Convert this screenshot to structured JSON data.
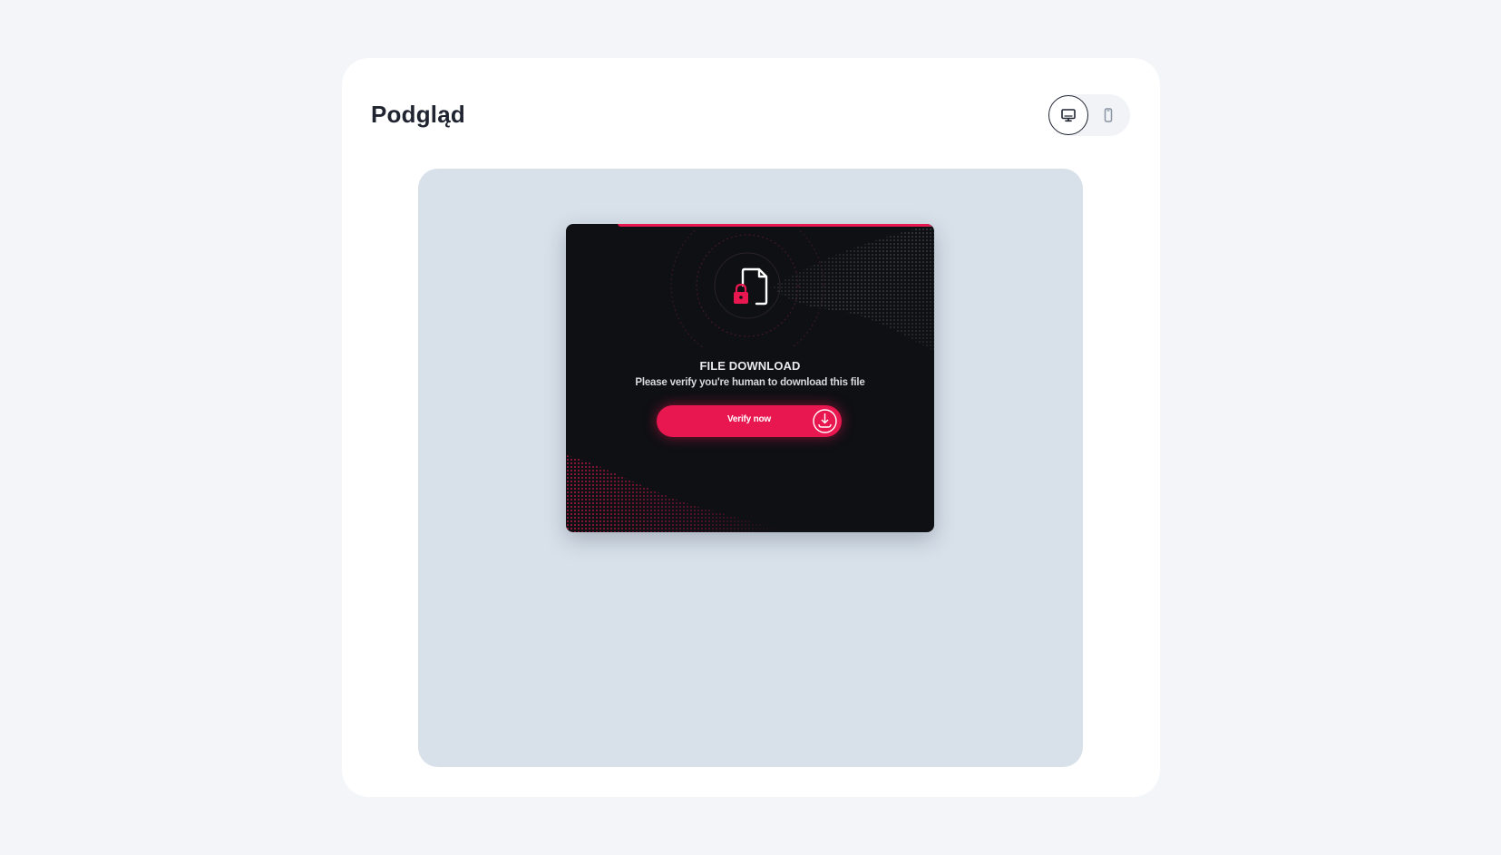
{
  "panel": {
    "title": "Podgląd"
  },
  "device_toggle": {
    "options": [
      {
        "icon": "desktop-icon",
        "active": true
      },
      {
        "icon": "mobile-icon",
        "active": false
      }
    ]
  },
  "popup": {
    "title": "FILE DOWNLOAD",
    "subtitle": "Please verify you're human to download this file",
    "button_label": "Verify now",
    "accent_color": "#e8174f",
    "background_color": "#0f1014"
  },
  "colors": {
    "page_bg": "#f3f5f9",
    "card_bg": "#ffffff",
    "preview_bg": "#d8e1ea",
    "text_dark": "#1f2430"
  }
}
